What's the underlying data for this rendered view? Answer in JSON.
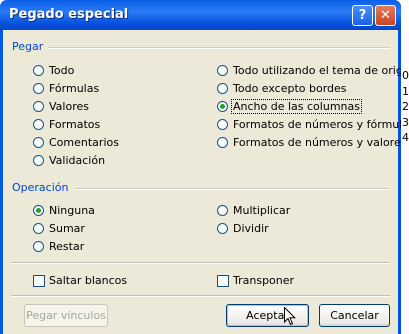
{
  "window": {
    "title": "Pegado especial",
    "help_glyph": "?",
    "close_glyph": "✕"
  },
  "pegar": {
    "title": "Pegar",
    "left": [
      {
        "label": "Todo",
        "checked": false
      },
      {
        "label": "Fórmulas",
        "checked": false
      },
      {
        "label": "Valores",
        "checked": false
      },
      {
        "label": "Formatos",
        "checked": false
      },
      {
        "label": "Comentarios",
        "checked": false
      },
      {
        "label": "Validación",
        "checked": false
      }
    ],
    "right": [
      {
        "label": "Todo utilizando el tema de origen",
        "checked": false
      },
      {
        "label": "Todo excepto bordes",
        "checked": false
      },
      {
        "label": "Ancho de las columnas",
        "checked": true
      },
      {
        "label": "Formatos de números y fórmulas",
        "checked": false
      },
      {
        "label": "Formatos de números y valores",
        "checked": false
      }
    ]
  },
  "operacion": {
    "title": "Operación",
    "left": [
      {
        "label": "Ninguna",
        "checked": true
      },
      {
        "label": "Sumar",
        "checked": false
      },
      {
        "label": "Restar",
        "checked": false
      }
    ],
    "right": [
      {
        "label": "Multiplicar",
        "checked": false
      },
      {
        "label": "Dividir",
        "checked": false
      }
    ]
  },
  "options": {
    "saltar_blancos": "Saltar blancos",
    "transponer": "Transponer"
  },
  "buttons": {
    "pegar_vinculos": "Pegar vínculos",
    "aceptar": "Aceptar",
    "cancelar": "Cancelar"
  },
  "background_digits": [
    "0",
    "1",
    "2",
    "3",
    "4"
  ],
  "colors": {
    "title_bar": "#0a5fe8",
    "dialog_bg": "#ece9d8",
    "group_title": "#0046d5",
    "radio_selected": "#21a121"
  }
}
